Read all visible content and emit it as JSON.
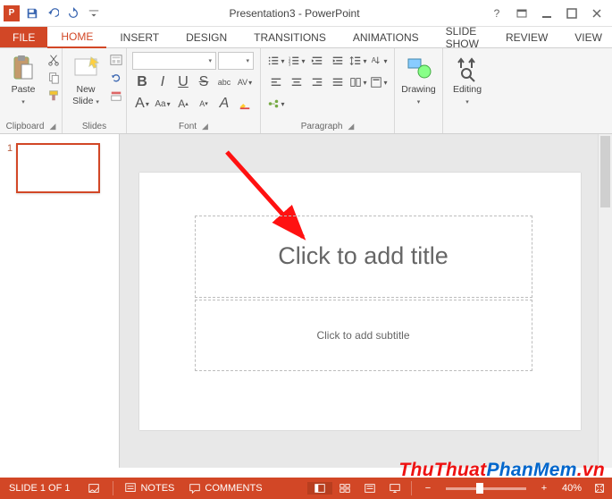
{
  "title": {
    "document": "Presentation3",
    "app": "PowerPoint"
  },
  "tabs": {
    "file": "FILE",
    "home": "HOME",
    "insert": "INSERT",
    "design": "DESIGN",
    "transitions": "TRANSITIONS",
    "animations": "ANIMATIONS",
    "slideshow": "SLIDE SHOW",
    "review": "REVIEW",
    "view": "VIEW"
  },
  "groups": {
    "clipboard": "Clipboard",
    "slides": "Slides",
    "font": "Font",
    "paragraph": "Paragraph",
    "drawing": "Drawing",
    "editing": "Editing"
  },
  "buttons": {
    "paste": "Paste",
    "newslide_l1": "New",
    "newslide_l2": "Slide",
    "drawing": "Drawing",
    "editing": "Editing"
  },
  "font": {
    "name": "",
    "size": "",
    "bold": "B",
    "italic": "I",
    "underline": "U",
    "strike": "S",
    "shadow": "abc",
    "spacing": "AV",
    "case": "Aa",
    "grow": "A",
    "shrink": "A",
    "clear": "A",
    "color": "A",
    "highlight": "A"
  },
  "slide": {
    "number": "1"
  },
  "placeholders": {
    "title": "Click to add title",
    "subtitle": "Click to add subtitle"
  },
  "status": {
    "counter": "SLIDE 1 OF 1",
    "notes": "NOTES",
    "comments": "COMMENTS",
    "zoom": "40%"
  },
  "watermark": {
    "a": "ThuThuat",
    "b": "PhanMem",
    "c": ".vn"
  }
}
